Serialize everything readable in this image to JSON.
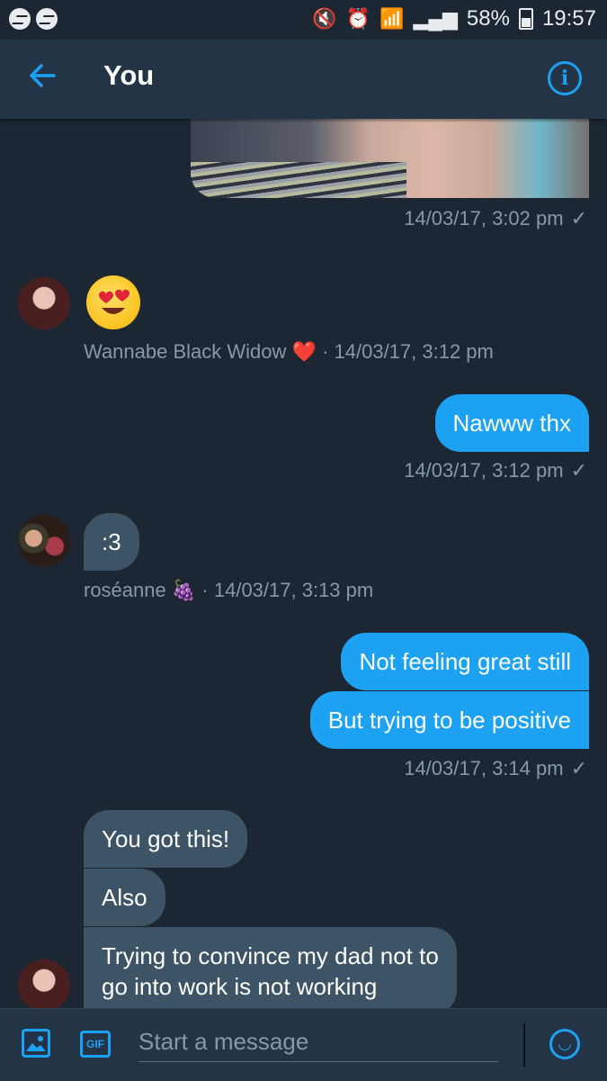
{
  "status_bar": {
    "battery": "58%",
    "time": "19:57",
    "left_icons": [
      "messenger-icon",
      "messenger-icon"
    ],
    "right_icons": [
      "mute-icon",
      "alarm-icon",
      "wifi-icon",
      "signal-icon",
      "battery-icon"
    ]
  },
  "header": {
    "title": "You",
    "back_icon": "arrow-left-icon",
    "info_icon": "info-icon"
  },
  "messages": {
    "photo": {
      "timestamp": "14/03/17, 3:02 pm",
      "check": "✓"
    },
    "m1": {
      "sender": "Wannabe Black Widow",
      "sender_emoji": "❤️",
      "separator": "·",
      "timestamp": "14/03/17, 3:12 pm",
      "content": "😍"
    },
    "m2": {
      "text": "Nawww thx",
      "timestamp": "14/03/17, 3:12 pm",
      "check": "✓"
    },
    "m3": {
      "text": ":3",
      "sender": "roséanne",
      "sender_emoji": "🍇",
      "separator": "·",
      "timestamp": "14/03/17, 3:13 pm"
    },
    "m4": {
      "text": "Not feeling great still",
      "text2": "But trying to be positive",
      "timestamp": "14/03/17, 3:14 pm",
      "check": "✓"
    },
    "m5": {
      "text": "You got this!",
      "text2": "Also",
      "text3_line1": "Trying to convince my dad not to",
      "text3_line2": "go into work is not working"
    }
  },
  "composer": {
    "placeholder": "Start a message",
    "gif_label": "GIF",
    "image_icon": "image-icon",
    "emoji_icon": "emoji-icon"
  },
  "colors": {
    "background": "#1c2733",
    "header": "#243447",
    "accent": "#1da1f2",
    "incoming_bubble": "#3d5466",
    "meta_text": "#8899a6"
  }
}
